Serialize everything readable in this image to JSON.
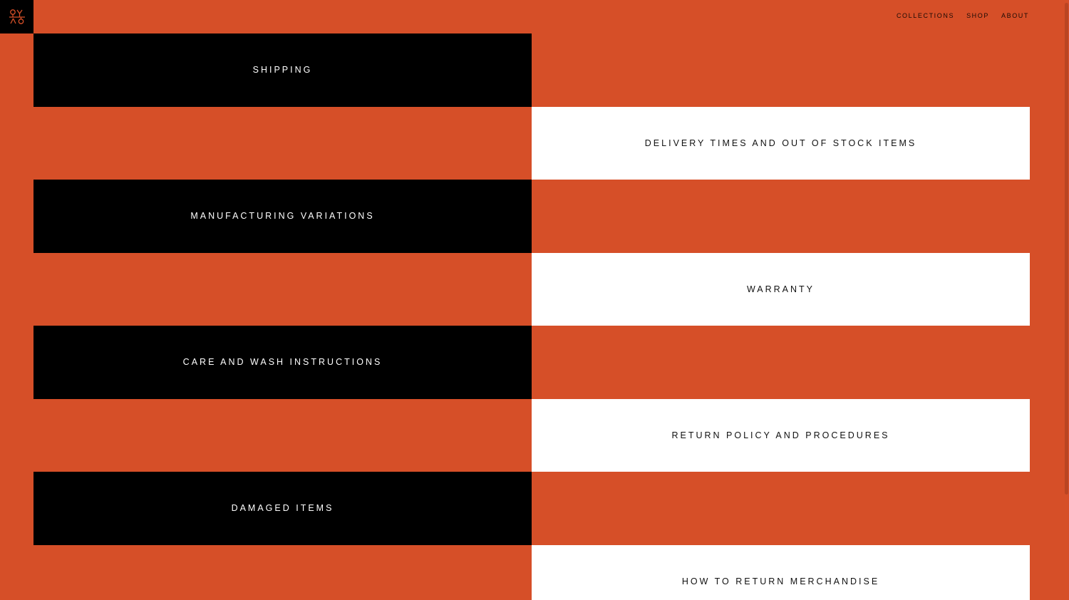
{
  "colors": {
    "background": "#d64f28",
    "dark_tile": "#000000",
    "light_tile": "#ffffff"
  },
  "logo": {
    "icon": "brand-monogram-icon"
  },
  "nav": {
    "items": [
      {
        "label": "COLLECTIONS"
      },
      {
        "label": "SHOP"
      },
      {
        "label": "ABOUT"
      }
    ]
  },
  "topics": [
    {
      "label": "SHIPPING",
      "side": "left",
      "style": "black"
    },
    {
      "label": "DELIVERY TIMES AND OUT OF STOCK ITEMS",
      "side": "right",
      "style": "white"
    },
    {
      "label": "MANUFACTURING VARIATIONS",
      "side": "left",
      "style": "black"
    },
    {
      "label": "WARRANTY",
      "side": "right",
      "style": "white"
    },
    {
      "label": "CARE AND WASH INSTRUCTIONS",
      "side": "left",
      "style": "black"
    },
    {
      "label": "RETURN POLICY AND PROCEDURES",
      "side": "right",
      "style": "white"
    },
    {
      "label": "DAMAGED ITEMS",
      "side": "left",
      "style": "black"
    },
    {
      "label": "HOW TO RETURN MERCHANDISE",
      "side": "right",
      "style": "white"
    }
  ]
}
